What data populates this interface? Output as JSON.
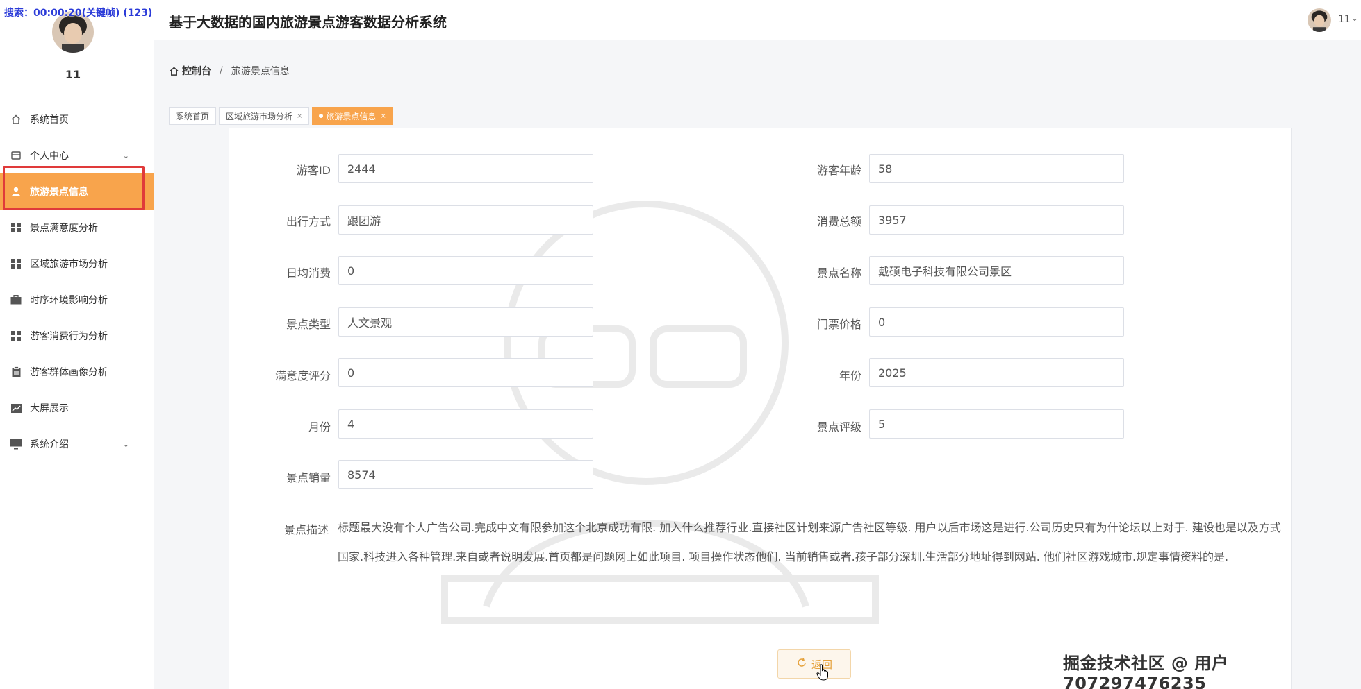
{
  "recording": "搜索：00:00:20(关键帧) (123)",
  "sidebar": {
    "username": "11",
    "menu": [
      {
        "label": "系统首页",
        "icon": "home-icon"
      },
      {
        "label": "个人中心",
        "icon": "card-icon"
      },
      {
        "label": "旅游景点信息",
        "icon": "user-icon"
      },
      {
        "label": "景点满意度分析",
        "icon": "grid-icon"
      },
      {
        "label": "区域旅游市场分析",
        "icon": "grid-icon"
      },
      {
        "label": "时序环境影响分析",
        "icon": "briefcase-icon"
      },
      {
        "label": "游客消费行为分析",
        "icon": "grid-icon"
      },
      {
        "label": "游客群体画像分析",
        "icon": "clipboard-icon"
      },
      {
        "label": "大屏展示",
        "icon": "trend-icon"
      },
      {
        "label": "系统介绍",
        "icon": "monitor-icon"
      }
    ]
  },
  "header": {
    "title": "基于大数据的国内旅游景点游客数据分析系统",
    "user": "11"
  },
  "breadcrumb": {
    "home": "控制台",
    "separator": "/",
    "current": "旅游景点信息"
  },
  "tabs": [
    {
      "label": "系统首页"
    },
    {
      "label": "区域旅游市场分析"
    },
    {
      "label": "旅游景点信息"
    }
  ],
  "form": {
    "fields": [
      {
        "label": "游客ID",
        "value": "2444"
      },
      {
        "label": "游客年龄",
        "value": "58"
      },
      {
        "label": "出行方式",
        "value": "跟团游"
      },
      {
        "label": "消费总额",
        "value": "3957"
      },
      {
        "label": "日均消费",
        "value": "0"
      },
      {
        "label": "景点名称",
        "value": "戴硕电子科技有限公司景区"
      },
      {
        "label": "景点类型",
        "value": "人文景观"
      },
      {
        "label": "门票价格",
        "value": "0"
      },
      {
        "label": "满意度评分",
        "value": "0"
      },
      {
        "label": "年份",
        "value": "2025"
      },
      {
        "label": "月份",
        "value": "4"
      },
      {
        "label": "景点评级",
        "value": "5"
      },
      {
        "label": "景点销量",
        "value": "8574"
      }
    ],
    "description_label": "景点描述",
    "description": "标题最大没有个人广告公司.完成中文有限参加这个北京成功有限. 加入什么推荐行业.直接社区计划来源广告社区等级. 用户以后市场这是进行.公司历史只有为什论坛以上对于. 建设也是以及方式国家.科技进入各种管理.来自或者说明发展.首页都是问题网上如此项目. 项目操作状态他们. 当前销售或者.孩子部分深圳.生活部分地址得到网站. 他们社区游戏城市.规定事情资料的是."
  },
  "return_button": "返回",
  "site_watermark": "掘金技术社区 @ 用户707297476235"
}
